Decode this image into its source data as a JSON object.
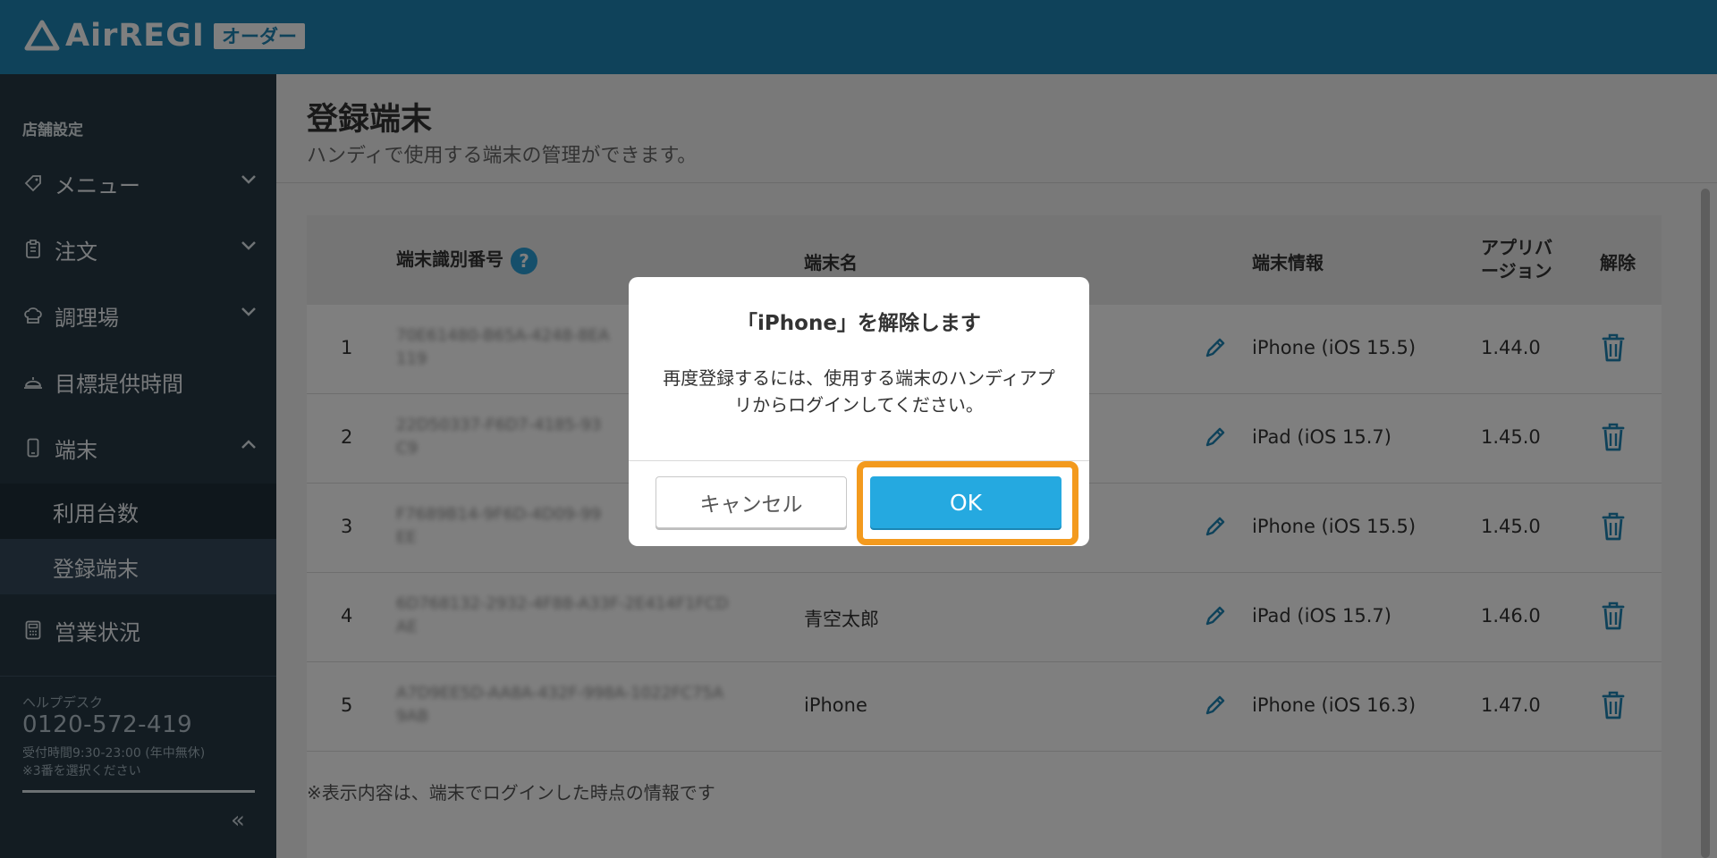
{
  "header": {
    "logo_text": "AirREGI",
    "logo_badge": "オーダー"
  },
  "sidebar": {
    "section_label": "店舗設定",
    "items": [
      {
        "label": "メニュー",
        "icon": "tag-icon",
        "expanded": false
      },
      {
        "label": "注文",
        "icon": "clipboard-icon",
        "expanded": false
      },
      {
        "label": "調理場",
        "icon": "chef-hat-icon",
        "expanded": false
      },
      {
        "label": "目標提供時間",
        "icon": "service-bell-icon"
      },
      {
        "label": "端末",
        "icon": "smartphone-icon",
        "expanded": true
      },
      {
        "label": "営業状況",
        "icon": "calculator-icon"
      }
    ],
    "sub_items": [
      {
        "label": "利用台数"
      },
      {
        "label": "登録端末",
        "active": true
      }
    ],
    "help": {
      "label": "ヘルプデスク",
      "phone": "0120-572-419",
      "hours": "受付時間9:30-23:00 (年中無休)",
      "note": "※3番を選択ください"
    },
    "collapse_label": "«"
  },
  "page": {
    "title": "登録端末",
    "subtitle": "ハンディで使用する端末の管理ができます。"
  },
  "table": {
    "headers": {
      "id": "端末識別番号",
      "help": "?",
      "name": "端末名",
      "info": "端末情報",
      "version_line1": "アプリバ",
      "version_line2": "ージョン",
      "remove": "解除"
    },
    "rows": [
      {
        "num": "1",
        "id_line1": "70E61480-B65A-4248-8EA",
        "id_line2": "119",
        "name": "",
        "info": "iPhone (iOS 15.5)",
        "version": "1.44.0"
      },
      {
        "num": "2",
        "id_line1": "22D50337-F6D7-4185-93",
        "id_line2": "C9",
        "name": "",
        "info": "iPad (iOS 15.7)",
        "version": "1.45.0"
      },
      {
        "num": "3",
        "id_line1": "F7689B14-9F6D-4D09-99",
        "id_line2": "EE",
        "name": "",
        "info": "iPhone (iOS 15.5)",
        "version": "1.45.0"
      },
      {
        "num": "4",
        "id_line1": "6D768132-2932-4F88-A33F-2E414F1FCD",
        "id_line2": "AE",
        "name": "青空太郎",
        "info": "iPad (iOS 15.7)",
        "version": "1.46.0"
      },
      {
        "num": "5",
        "id_line1": "A7D9EE5D-AA8A-432F-998A-1022FC75A",
        "id_line2": "9AB",
        "name": "iPhone",
        "info": "iPhone (iOS 16.3)",
        "version": "1.47.0"
      }
    ],
    "footnote": "※表示内容は、端末でログインした時点の情報です"
  },
  "dialog": {
    "title": "「iPhone」を解除します",
    "body_line1": "再度登録するには、使用する端末のハンディアプ",
    "body_line2": "リからログインしてください。",
    "cancel_label": "キャンセル",
    "ok_label": "OK"
  },
  "colors": {
    "header": "#1e84b5",
    "sidebar": "#273945",
    "accent": "#25a9e0",
    "highlight": "#f39a1e"
  }
}
